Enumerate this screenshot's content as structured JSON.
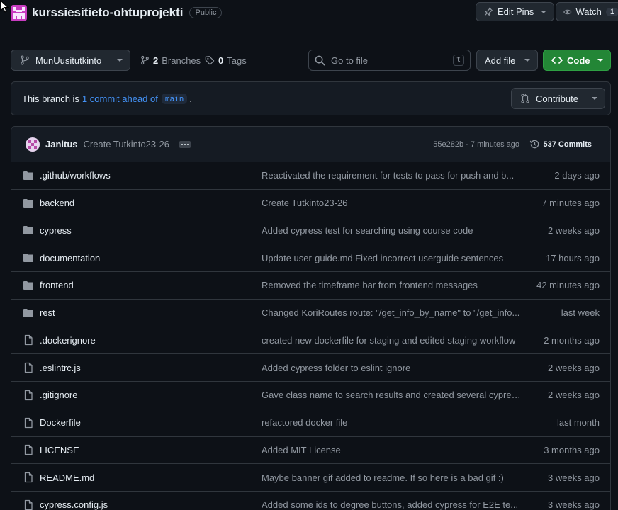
{
  "repo": {
    "name": "kurssiesitieto-ohtuprojekti",
    "visibility": "Public"
  },
  "header_actions": {
    "edit_pins_label": "Edit Pins",
    "watch_label": "Watch",
    "watch_count": "1"
  },
  "toolbar": {
    "branch_name": "MunUusitutkinto",
    "branches_count": "2",
    "branches_label": "Branches",
    "tags_count": "0",
    "tags_label": "Tags",
    "search_placeholder": "Go to file",
    "search_shortcut": "t",
    "add_file_label": "Add file",
    "code_label": "Code"
  },
  "banner": {
    "prefix": "This branch is",
    "link_text": "1 commit ahead of",
    "branch": "main",
    "suffix": ".",
    "contribute_label": "Contribute"
  },
  "latest_commit": {
    "user": "Janitus",
    "message": "Create Tutkinto23-26",
    "meta": "55e282b · 7 minutes ago",
    "commits_count": "537 Commits"
  },
  "files": [
    {
      "type": "folder",
      "name": ".github/workflows",
      "message": "Reactivated the requirement for tests to pass for push and b...",
      "date": "2 days ago"
    },
    {
      "type": "folder",
      "name": "backend",
      "message": "Create Tutkinto23-26",
      "date": "7 minutes ago"
    },
    {
      "type": "folder",
      "name": "cypress",
      "message": "Added cypress test for searching using course code",
      "date": "2 weeks ago"
    },
    {
      "type": "folder",
      "name": "documentation",
      "message": "Update user-guide.md Fixed incorrect userguide sentences",
      "date": "17 hours ago"
    },
    {
      "type": "folder",
      "name": "frontend",
      "message": "Removed the timeframe bar from frontend messages",
      "date": "42 minutes ago"
    },
    {
      "type": "folder",
      "name": "rest",
      "message": "Changed KoriRoutes route: \"/get_info_by_name\" to \"/get_info...",
      "date": "last week"
    },
    {
      "type": "file",
      "name": ".dockerignore",
      "message": "created new dockerfile for staging and edited staging workflow",
      "date": "2 months ago"
    },
    {
      "type": "file",
      "name": ".eslintrc.js",
      "message": "Added cypress folder to eslint ignore",
      "date": "2 weeks ago"
    },
    {
      "type": "file",
      "name": ".gitignore",
      "message": "Gave class name to search results and created several cypres...",
      "date": "2 weeks ago"
    },
    {
      "type": "file",
      "name": "Dockerfile",
      "message": "refactored docker file",
      "date": "last month"
    },
    {
      "type": "file",
      "name": "LICENSE",
      "message": "Added MIT License",
      "date": "3 months ago"
    },
    {
      "type": "file",
      "name": "README.md",
      "message": "Maybe banner gif added to readme. If so here is a bad gif :)",
      "date": "3 weeks ago"
    },
    {
      "type": "file",
      "name": "cypress.config.js",
      "message": "Added some ids to degree buttons, added cypress for E2E te...",
      "date": "3 weeks ago"
    }
  ],
  "colors": {
    "background": "#0d1117",
    "accent_link": "#4493f8",
    "code_button": "#238636",
    "muted_text": "#9198a1",
    "border": "#30363d"
  }
}
